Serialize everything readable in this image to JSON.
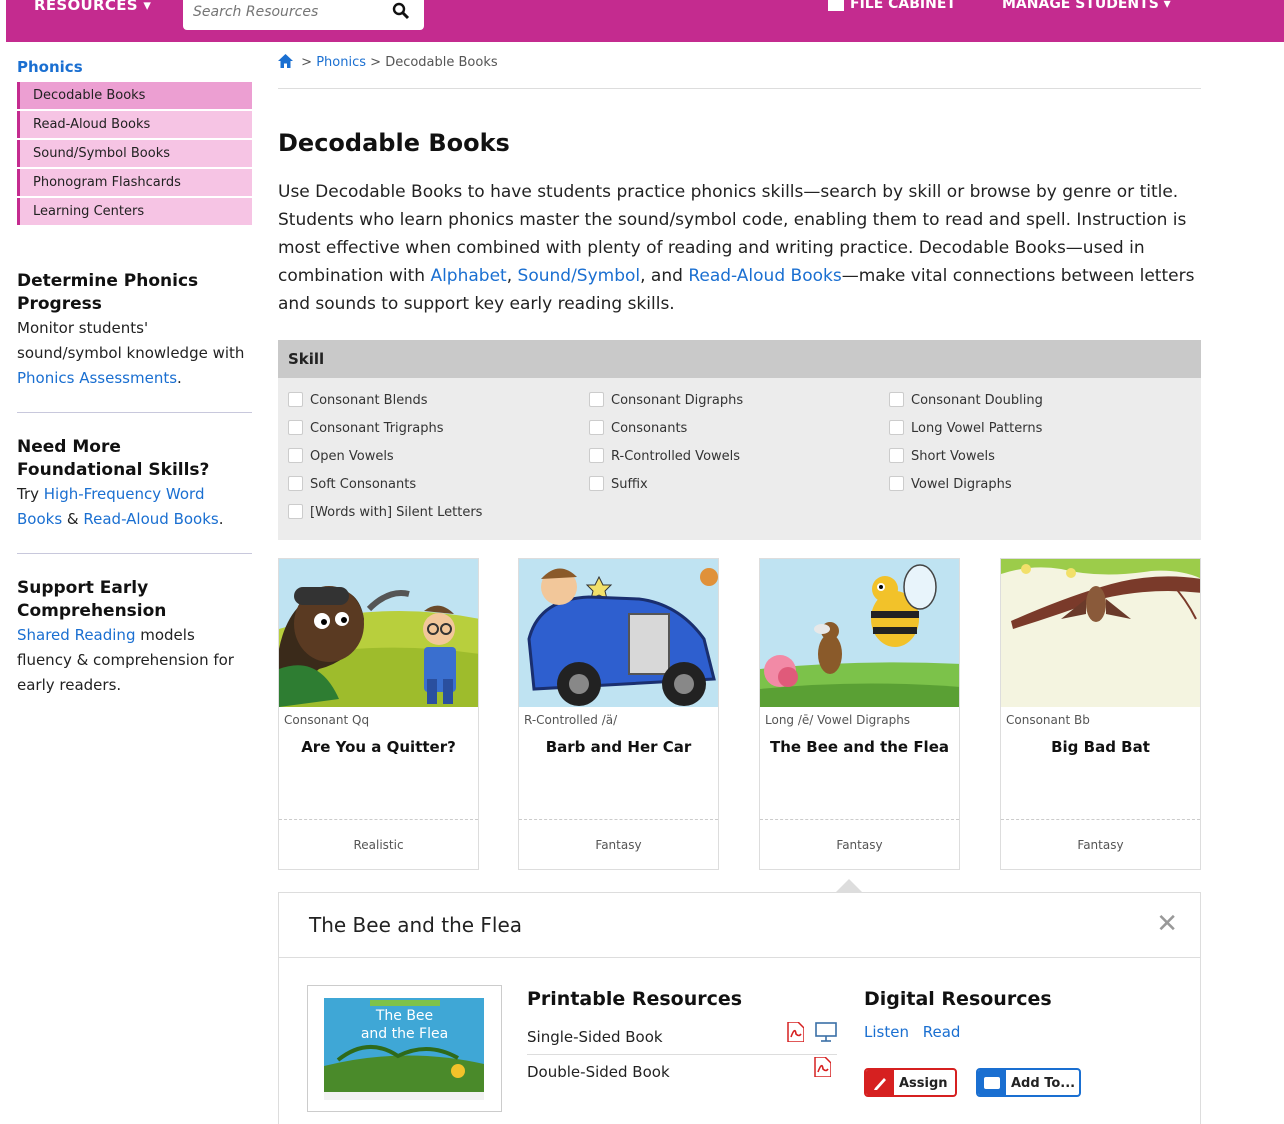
{
  "topbar": {
    "resources_label": "RESOURCES",
    "search_placeholder": "Search Resources",
    "file_cabinet_label": "FILE CABINET",
    "manage_students_label": "MANAGE STUDENTS",
    "brand_color": "#c42b8f"
  },
  "sidebar": {
    "section_title": "Phonics",
    "items": [
      {
        "label": "Decodable Books",
        "active": true
      },
      {
        "label": "Read-Aloud Books"
      },
      {
        "label": "Sound/Symbol Books"
      },
      {
        "label": "Phonogram Flashcards"
      },
      {
        "label": "Learning Centers"
      }
    ],
    "blocks": {
      "progress": {
        "title": "Determine Phonics Progress",
        "text_before": "Monitor students' sound/symbol knowledge with ",
        "link": "Phonics Assessments",
        "text_after": "."
      },
      "skills": {
        "title": "Need More Foundational Skills?",
        "text_before": "Try ",
        "link1": "High-Frequency Word Books",
        "mid": " & ",
        "link2": "Read-Aloud Books",
        "text_after": "."
      },
      "comprehension": {
        "title": "Support Early Comprehension",
        "link": "Shared Reading",
        "text_after": " models fluency & comprehension for early readers."
      }
    }
  },
  "breadcrumb": {
    "sep": ">",
    "parent": "Phonics",
    "current": "Decodable Books"
  },
  "page": {
    "title": "Decodable Books",
    "intro": {
      "p1": "Use Decodable Books to have students practice phonics skills—search by skill or browse by genre or title. Students who learn phonics master the sound/symbol code, enabling them to read and spell. Instruction is most effective when combined with plenty of reading and writing practice. Decodable Books—used in combination with ",
      "link1": "Alphabet",
      "comma": ", ",
      "link2": "Sound/Symbol",
      "and": ", and ",
      "link3": "Read-Aloud Books",
      "p2": "—make vital connections between letters and sounds to support key early reading skills."
    }
  },
  "skill_filter": {
    "header": "Skill",
    "options": [
      "Consonant Blends",
      "Consonant Digraphs",
      "Consonant Doubling",
      "Consonant Trigraphs",
      "Consonants",
      "Long Vowel Patterns",
      "Open Vowels",
      "R-Controlled Vowels",
      "Short Vowels",
      "Soft Consonants",
      "Suffix",
      "Vowel Digraphs",
      "[Words with] Silent Letters"
    ]
  },
  "books": [
    {
      "skill": "Consonant Qq",
      "title": "Are You a Quitter?",
      "genre": "Realistic"
    },
    {
      "skill": "R-Controlled /ä/",
      "title": "Barb and Her Car",
      "genre": "Fantasy"
    },
    {
      "skill": "Long /ē/ Vowel Digraphs",
      "title": "The Bee and the Flea",
      "genre": "Fantasy"
    },
    {
      "skill": "Consonant Bb",
      "title": "Big Bad Bat",
      "genre": "Fantasy"
    }
  ],
  "detail": {
    "title": "The Bee and the Flea",
    "cover_title_line1": "The Bee",
    "cover_title_line2": "and the Flea",
    "printable": {
      "heading": "Printable Resources",
      "rows": [
        "Single-Sided Book",
        "Double-Sided Book"
      ]
    },
    "digital": {
      "heading": "Digital Resources",
      "listen": "Listen",
      "read": "Read",
      "assign": "Assign",
      "add_to": "Add To..."
    }
  }
}
